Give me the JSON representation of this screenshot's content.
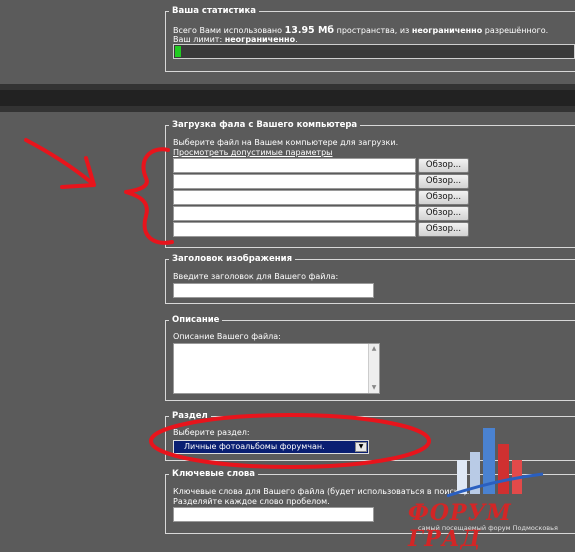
{
  "stats": {
    "legend": "Ваша статистика",
    "line1_prefix": "Всего Вами использовано",
    "used_value": "13.95 Мб",
    "line1_mid": "пространства, из",
    "unlimited_word": "неограниченно",
    "line1_suffix": "разрешённого.",
    "limit_prefix": "Ваш лимит:",
    "limit_value": "неограниченно",
    "limit_suffix": ".",
    "progress_fraction": 0.015
  },
  "upload": {
    "legend": "Загрузка фала с Вашего компьютера",
    "instruction": "Выберите файл на Вашем компьютере для загрузки.",
    "params_link": "Просмотреть допустимые параметры",
    "browse_labels": [
      "Обзор...",
      "Обзор...",
      "Обзор...",
      "Обзор...",
      "Обзор..."
    ]
  },
  "title_section": {
    "legend": "Заголовок изображения",
    "label": "Введите заголовок для Вашего файла:"
  },
  "description": {
    "legend": "Описание",
    "label": "Описание Вашего файла:"
  },
  "category": {
    "legend": "Раздел",
    "label": "Выберите раздел:",
    "selected": "Личные фотоальбомы форумчан."
  },
  "keywords": {
    "legend": "Ключевые слова",
    "line1": "Ключевые слова для Вашего файла (будет использоваться в поиске).",
    "line2": "Разделяйте каждое слово пробелом."
  },
  "watermark": {
    "brand": "ФОРУМ ГРАД",
    "tagline": "самый посещаемый форум Подмосковья"
  },
  "colors": {
    "background": "#5b5b5b",
    "annotation_red": "#e8141c",
    "select_bg": "#0a1f72",
    "progress_fill": "#22cc22"
  }
}
